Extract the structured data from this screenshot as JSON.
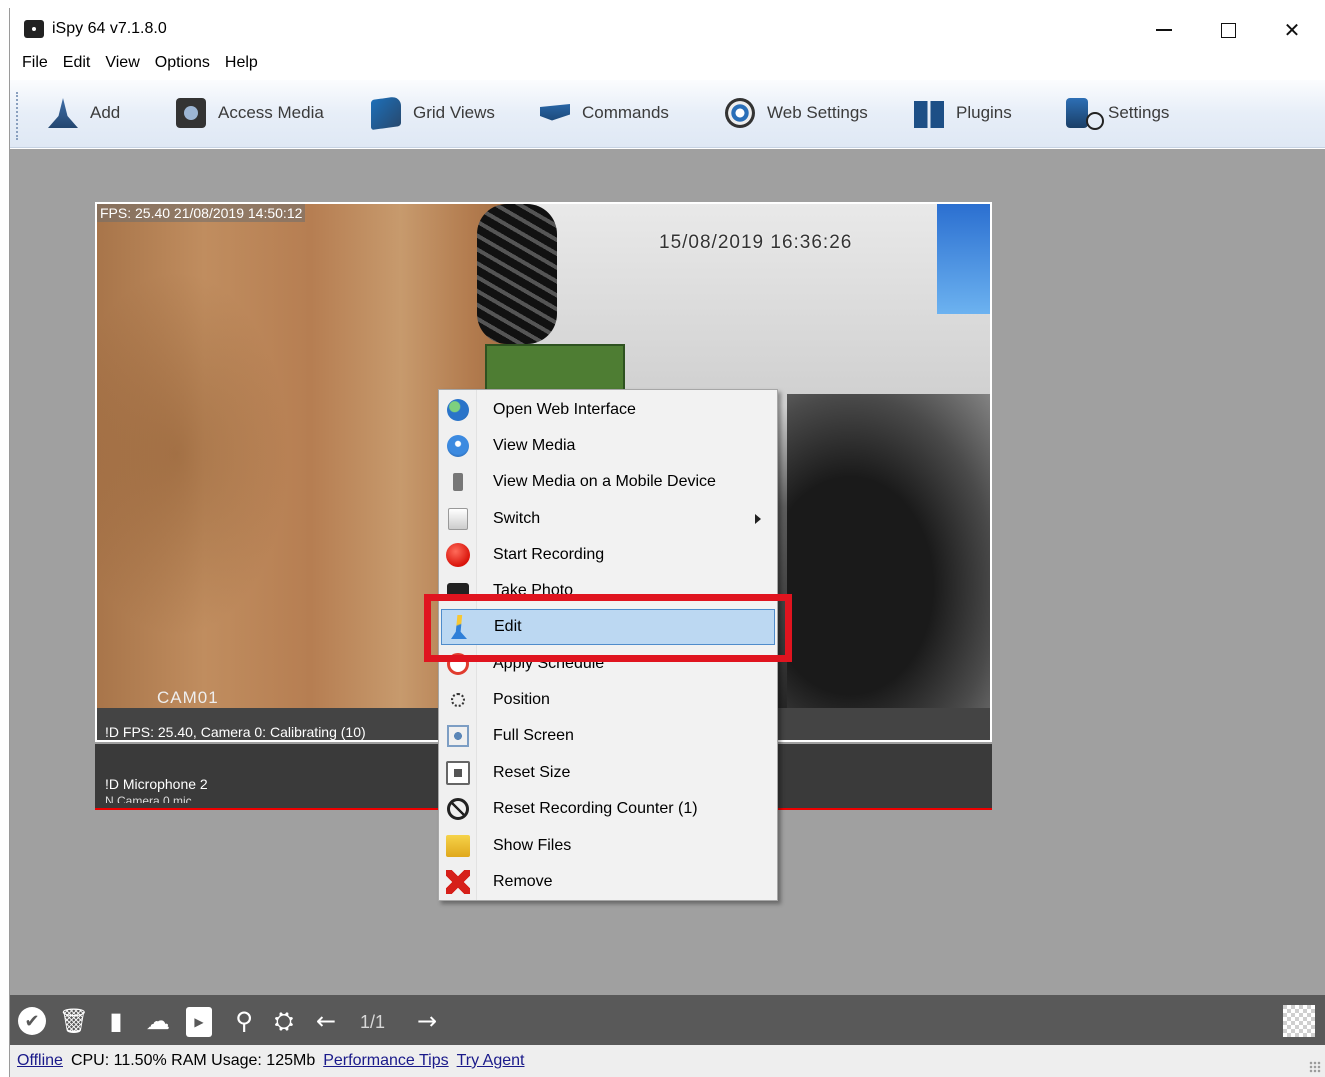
{
  "window": {
    "title": "iSpy 64 v7.1.8.0"
  },
  "menubar": [
    "File",
    "Edit",
    "View",
    "Options",
    "Help"
  ],
  "toolbar": [
    {
      "label": "Add",
      "icon": "add-camera-icon"
    },
    {
      "label": "Access Media",
      "icon": "access-media-icon"
    },
    {
      "label": "Grid Views",
      "icon": "grid-views-icon"
    },
    {
      "label": "Commands",
      "icon": "commands-icon"
    },
    {
      "label": "Web Settings",
      "icon": "web-settings-icon"
    },
    {
      "label": "Plugins",
      "icon": "plugins-icon"
    },
    {
      "label": "Settings",
      "icon": "settings-icon"
    }
  ],
  "camera": {
    "osd_top": "FPS: 25.40 21/08/2019 14:50:12",
    "osd_timestamp": "15/08/2019 16:36:26",
    "cam_label": "CAM01",
    "status": "!D  FPS: 25.40, Camera 0: Calibrating (10)"
  },
  "microphone": {
    "label": "!D  Microphone 2",
    "sub_label": "N  Camera 0 mic"
  },
  "context_menu": {
    "items": [
      {
        "label": "Open Web Interface",
        "icon": "globe-icon"
      },
      {
        "label": "View Media",
        "icon": "view-media-icon"
      },
      {
        "label": "View Media on a Mobile Device",
        "icon": "mobile-icon"
      },
      {
        "label": "Switch",
        "icon": "switch-icon",
        "submenu": true
      },
      {
        "label": "Start Recording",
        "icon": "record-icon"
      },
      {
        "label": "Take Photo",
        "icon": "camera-icon"
      },
      {
        "label": "Edit",
        "icon": "edit-icon",
        "active": true
      },
      {
        "label": "Apply Schedule",
        "icon": "schedule-icon"
      },
      {
        "label": "Position",
        "icon": "position-icon"
      },
      {
        "label": "Full Screen",
        "icon": "fullscreen-icon"
      },
      {
        "label": "Reset Size",
        "icon": "reset-size-icon"
      },
      {
        "label": "Reset Recording Counter (1)",
        "icon": "no-entry-icon"
      },
      {
        "label": "Show Files",
        "icon": "folder-icon"
      },
      {
        "label": "Remove",
        "icon": "remove-icon"
      }
    ],
    "highlight_color": "#e0141f"
  },
  "bottombar": {
    "page": "1/1",
    "icons": [
      "check-icon",
      "trash-icon",
      "bookmark-icon",
      "cloud-upload-icon",
      "youtube-icon",
      "search-icon",
      "network-icon",
      "arrow-left-icon",
      "arrow-right-icon"
    ]
  },
  "statusbar": {
    "offline": "Offline",
    "stats": "CPU: 11.50% RAM Usage: 125Mb",
    "performance": "Performance Tips",
    "agent": "Try Agent"
  }
}
